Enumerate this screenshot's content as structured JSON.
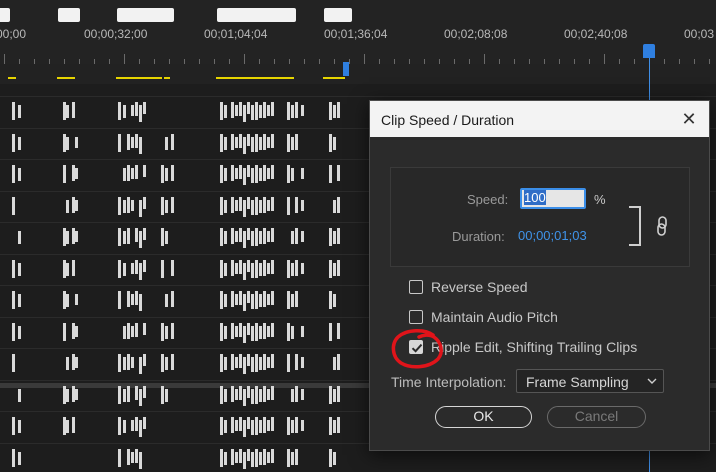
{
  "timeline": {
    "timecodes": [
      "00;00",
      "00;00;32;00",
      "00;01;04;04",
      "00;01;36;04",
      "00;02;08;08",
      "00;02;40;08",
      "00;03"
    ],
    "accent_color": "#2f7fe0",
    "marker_color": "#e6d400"
  },
  "dialog": {
    "title": "Clip Speed / Duration",
    "close_glyph": "✕",
    "speed_label": "Speed:",
    "speed_value": "100",
    "speed_unit": "%",
    "duration_label": "Duration:",
    "duration_value": "00;00;01;03",
    "reverse_speed_label": "Reverse Speed",
    "reverse_speed_checked": false,
    "maintain_audio_label": "Maintain Audio Pitch",
    "maintain_audio_checked": false,
    "ripple_edit_label": "Ripple Edit, Shifting Trailing Clips",
    "ripple_edit_checked": true,
    "time_interpolation_label": "Time Interpolation:",
    "time_interpolation_value": "Frame Sampling",
    "ok_label": "OK",
    "cancel_label": "Cancel",
    "link_icon": "chain-link-icon",
    "annotation_color": "#e0141a"
  }
}
